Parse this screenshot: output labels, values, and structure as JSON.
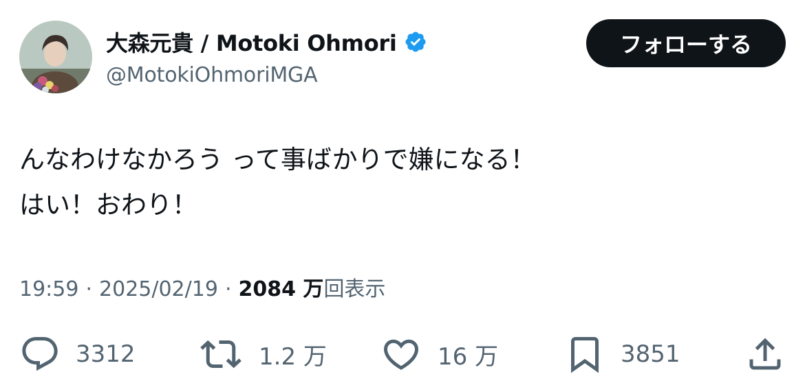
{
  "author": {
    "display_name": "大森元貴 / Motoki Ohmori",
    "handle": "@MotokiOhmoriMGA",
    "verified_color": "#1d9bf0"
  },
  "follow_button": {
    "label": "フォローする"
  },
  "tweet": {
    "lines": [
      "んなわけなかろう って事ばかりで嫌になる！",
      "はい！おわり！"
    ]
  },
  "meta": {
    "time": "19:59",
    "separator": "·",
    "date": "2025/02/19",
    "views_count": "2084 万",
    "views_label": "回表示"
  },
  "actions": {
    "reply": {
      "icon": "reply-icon",
      "count": "3312"
    },
    "retweet": {
      "icon": "retweet-icon",
      "count": "1.2 万"
    },
    "like": {
      "icon": "heart-icon",
      "count": "16 万"
    },
    "bookmark": {
      "icon": "bookmark-icon",
      "count": "3851"
    },
    "share": {
      "icon": "share-icon"
    }
  }
}
